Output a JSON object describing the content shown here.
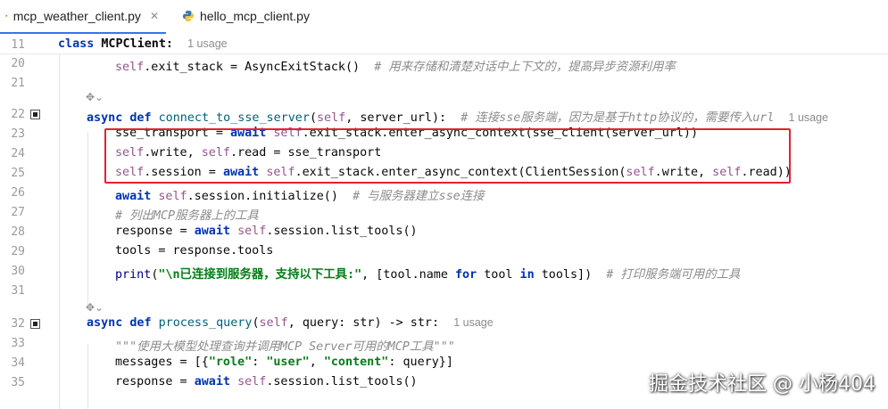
{
  "tabs": [
    {
      "label": "mcp_weather_client.py",
      "active": true
    },
    {
      "label": "hello_mcp_client.py",
      "active": false
    }
  ],
  "lines": {
    "l11": {
      "num": "11",
      "kw": "class",
      "name": "MCPClient:",
      "usage": "1 usage"
    },
    "l20": {
      "num": "20",
      "self": "self",
      "rest": ".exit_stack = AsyncExitStack()",
      "comment": "# 用来存储和清楚对话中上下文的，提高异步资源利用率"
    },
    "l21": {
      "num": "21"
    },
    "l22": {
      "num": "22",
      "kw": "async def",
      "name": "connect_to_sse_server",
      "args_open": "(",
      "self": "self",
      "args_rest": ", server_url):",
      "comment": "# 连接sse服务端，因为是基于http协议的，需要传入url",
      "usage": "1 usage"
    },
    "l23": {
      "num": "23",
      "a": "sse_transport = ",
      "await": "await",
      "self": "self",
      "b": ".exit_stack.enter_async_context(sse_client(server_url))"
    },
    "l24": {
      "num": "24",
      "self1": "self",
      "a": ".write, ",
      "self2": "self",
      "b": ".read = sse_transport"
    },
    "l25": {
      "num": "25",
      "self1": "self",
      "a": ".session = ",
      "await": "await",
      "self2": "self",
      "b": ".exit_stack.enter_async_context(ClientSession(",
      "self3": "self",
      "c": ".write, ",
      "self4": "self",
      "d": ".read))"
    },
    "l26": {
      "num": "26",
      "await": "await",
      "self": "self",
      "a": ".session.initialize()",
      "comment": "# 与服务器建立sse连接"
    },
    "l27": {
      "num": "27",
      "comment": "# 列出MCP服务器上的工具"
    },
    "l28": {
      "num": "28",
      "a": "response = ",
      "await": "await",
      "self": "self",
      "b": ".session.list_tools()"
    },
    "l29": {
      "num": "29",
      "a": "tools = response.tools"
    },
    "l30": {
      "num": "30",
      "print": "print",
      "a": "(",
      "str": "\"\\n已连接到服务器，支持以下工具:\"",
      "b": ", [tool.name ",
      "for": "for",
      "c": " tool ",
      "in": "in",
      "d": " tools])",
      "comment": "# 打印服务端可用的工具"
    },
    "l31": {
      "num": "31"
    },
    "l32": {
      "num": "32",
      "kw": "async def",
      "name": "process_query",
      "args_open": "(",
      "self": "self",
      "args_rest": ", query: str) -> str:",
      "usage": "1 usage"
    },
    "l33": {
      "num": "33",
      "doc": "\"\"\"使用大模型处理查询并调用MCP Server可用的MCP工具\"\"\""
    },
    "l34": {
      "num": "34",
      "a": "messages = [{",
      "s1": "\"role\"",
      "b": ": ",
      "s2": "\"user\"",
      "c": ", ",
      "s3": "\"content\"",
      "d": ": query}]"
    },
    "l35": {
      "num": "35",
      "a": "response = ",
      "await": "await",
      "self": "self",
      "b": ".session.list_tools()"
    }
  },
  "watermark": "掘金技术社区 @ 小杨404",
  "colors": {
    "keyword": "#0033b3",
    "self": "#94558d",
    "string": "#067d17",
    "comment": "#8c8c8c",
    "highlight_box": "#e5212e"
  }
}
